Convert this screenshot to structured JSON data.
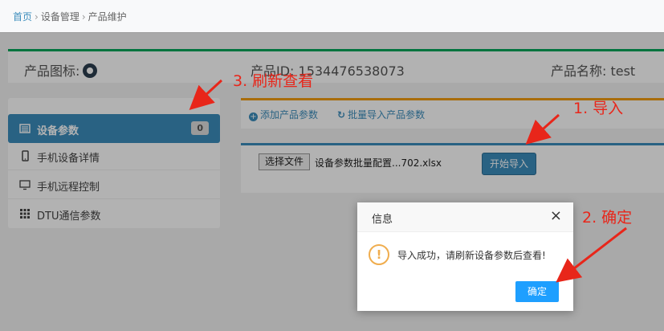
{
  "breadcrumb": {
    "home": "首页",
    "section": "设备管理",
    "current": "产品维护"
  },
  "product": {
    "icon_label": "产品图标:",
    "id_label": "产品ID: 1534476538073",
    "name_label": "产品名称: test"
  },
  "menu": {
    "items": [
      {
        "label": "设备参数",
        "badge": "0",
        "icon": "list-icon"
      },
      {
        "label": "手机设备详情",
        "icon": "mobile-icon"
      },
      {
        "label": "手机远程控制",
        "icon": "monitor-icon"
      },
      {
        "label": "DTU通信参数",
        "icon": "grid-icon"
      }
    ]
  },
  "toolbar": {
    "add_label": "添加产品参数",
    "bulk_import_label": "批量导入产品参数"
  },
  "upload": {
    "choose_file_label": "选择文件",
    "file_name": "设备参数批量配置...702.xlsx",
    "start_import_label": "开始导入"
  },
  "dialog": {
    "title": "信息",
    "message": "导入成功，请刷新设备参数后查看!",
    "ok_label": "确定",
    "close_symbol": "×"
  },
  "annotations": {
    "step1": "1. 导入",
    "step2": "2. 确定",
    "step3": "3. 刷新查看"
  },
  "colors": {
    "primary": "#3c8dbc",
    "success": "#00a65a",
    "warning": "#f39c12",
    "dialog_ok": "#1e9fff",
    "annotation": "#e8261a"
  }
}
